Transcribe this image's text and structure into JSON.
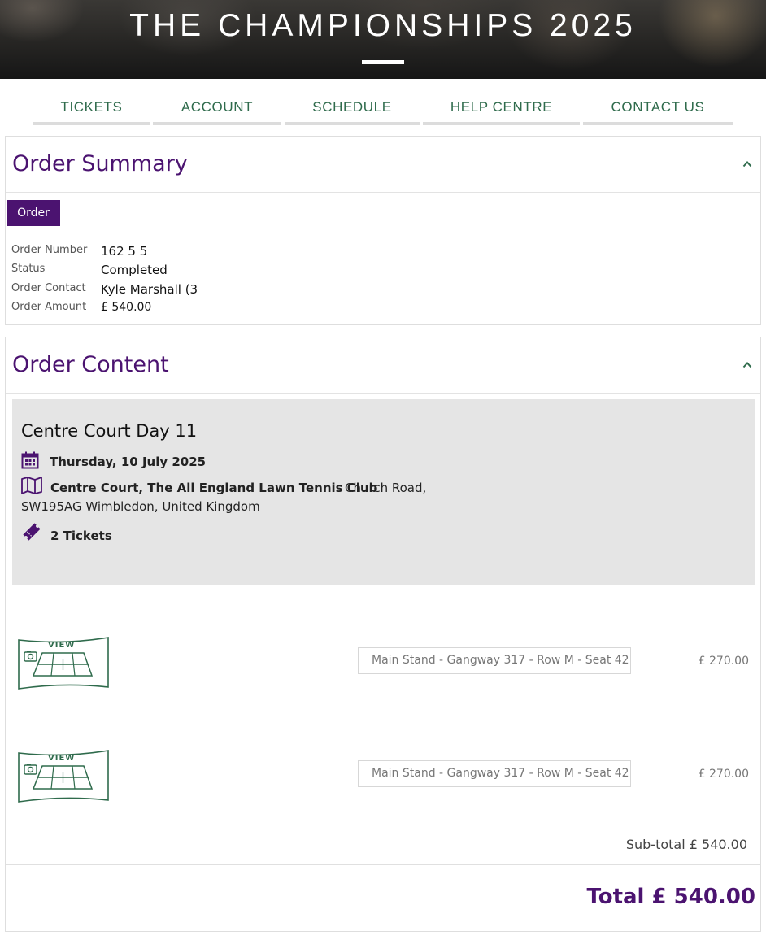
{
  "header": {
    "title": "THE CHAMPIONSHIPS 2025"
  },
  "nav": {
    "tabs": [
      "TICKETS",
      "ACCOUNT",
      "SCHEDULE",
      "HELP CENTRE",
      "CONTACT US"
    ]
  },
  "order_summary": {
    "title": "Order Summary",
    "order_tab_label": "Order",
    "fields": [
      {
        "label": "Order Number",
        "value": "162 5 5"
      },
      {
        "label": "Status",
        "value": "Completed"
      },
      {
        "label": "Order Contact",
        "value": "Kyle Marshall (3"
      },
      {
        "label": "Order Amount",
        "value": "£ 540.00"
      }
    ]
  },
  "order_content": {
    "title": "Order Content",
    "event": {
      "name": "Centre Court Day 11",
      "date": "Thursday, 10 July 2025",
      "venue": "Centre Court, The All England Lawn Tennis Club",
      "address_line1": "Church Road,",
      "address_line2": "SW195AG Wimbledon, United Kingdom",
      "ticket_count": "2 Tickets"
    },
    "view_label": "VIEW",
    "tickets": [
      {
        "seat": "Main Stand - Gangway 317 - Row M - Seat 42",
        "price": "£ 270.00"
      },
      {
        "seat": "Main Stand - Gangway 317 - Row M - Seat 42",
        "price": "£ 270.00"
      }
    ],
    "subtotal": "Sub-total £ 540.00",
    "total": "Total  £ 540.00"
  },
  "colors": {
    "brand_purple": "#4b1370",
    "brand_green": "#2f6b4c",
    "card_grey": "#e5e5e5"
  }
}
